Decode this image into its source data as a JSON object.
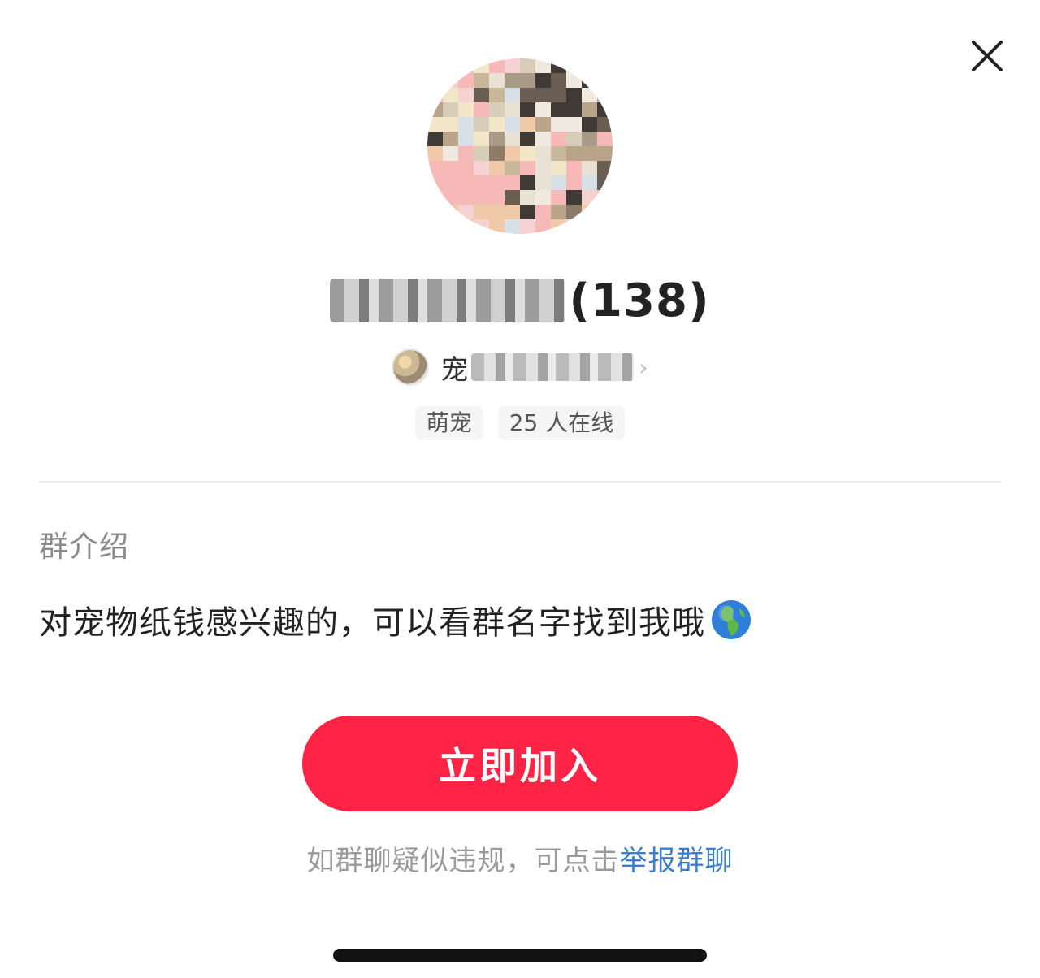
{
  "group": {
    "name_suffix": "(138)",
    "owner_prefix": "宠",
    "tags": [
      "萌宠",
      "25 人在线"
    ]
  },
  "intro": {
    "label": "群介绍",
    "text": "对宠物纸钱感兴趣的，可以看群名字找到我哦",
    "emoji_icon": "globe-icon"
  },
  "actions": {
    "join_label": "立即加入",
    "report_prefix": "如群聊疑似违规，可点击",
    "report_link": "举报群聊"
  },
  "colors": {
    "accent": "#ff2446",
    "link": "#3b7ecf"
  }
}
